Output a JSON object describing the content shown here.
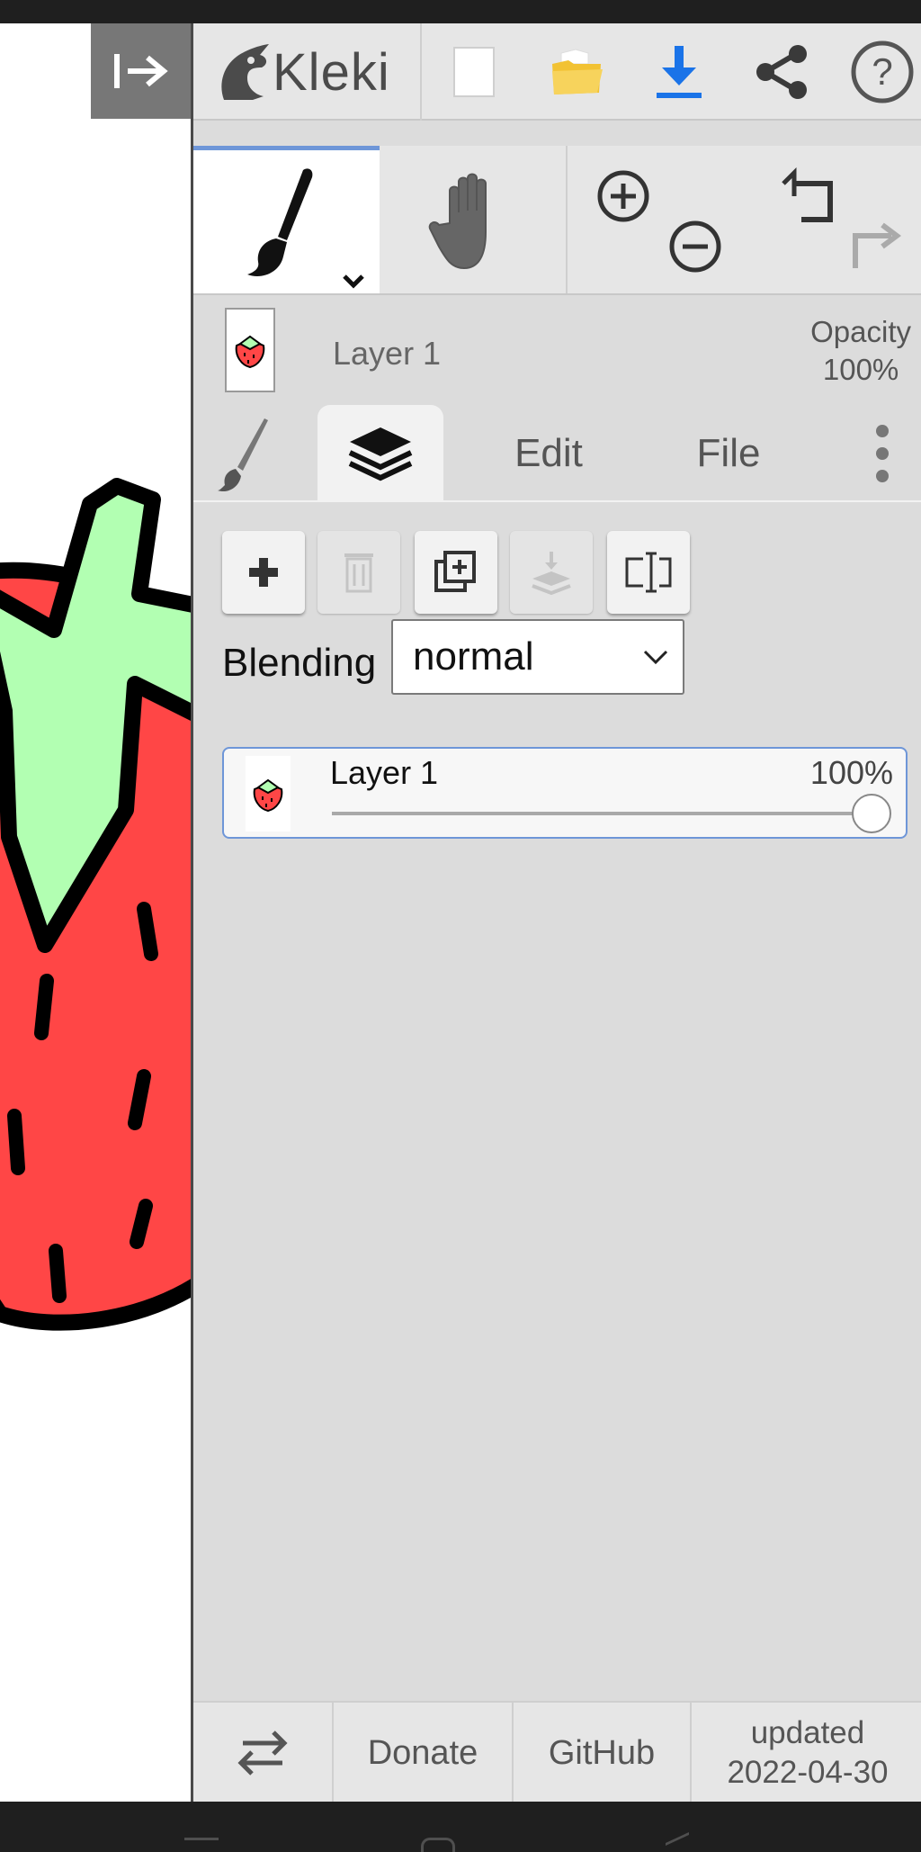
{
  "app": {
    "logo_text": "Kleki"
  },
  "layer_info": {
    "name": "Layer 1",
    "opacity_label": "Opacity",
    "opacity_value": "100%"
  },
  "tabs": [
    {
      "id": "brush",
      "icon": "brush-icon"
    },
    {
      "id": "layers",
      "icon": "layers-icon",
      "active": true
    },
    {
      "id": "edit",
      "label": "Edit"
    },
    {
      "id": "file",
      "label": "File"
    },
    {
      "id": "more",
      "icon": "more-vertical-icon"
    }
  ],
  "layers_panel": {
    "buttons": [
      {
        "icon": "add-icon",
        "enabled": true
      },
      {
        "icon": "trash-icon",
        "enabled": false
      },
      {
        "icon": "duplicate-icon",
        "enabled": true
      },
      {
        "icon": "merge-down-icon",
        "enabled": false
      },
      {
        "icon": "rename-icon",
        "enabled": true
      }
    ],
    "blending_label": "Blending",
    "blending_value": "normal",
    "layers": [
      {
        "name": "Layer 1",
        "opacity_text": "100%",
        "opacity": 1.0,
        "selected": true
      }
    ]
  },
  "footer": {
    "donate": "Donate",
    "github": "GitHub",
    "updated_label": "updated",
    "updated_date": "2022-04-30"
  },
  "colors": {
    "accent": "#6e96d8",
    "download": "#1a73e8",
    "folder": "#f2c233",
    "strawberry_red": "#ff4646",
    "leaf_green": "#b2ffb2"
  }
}
